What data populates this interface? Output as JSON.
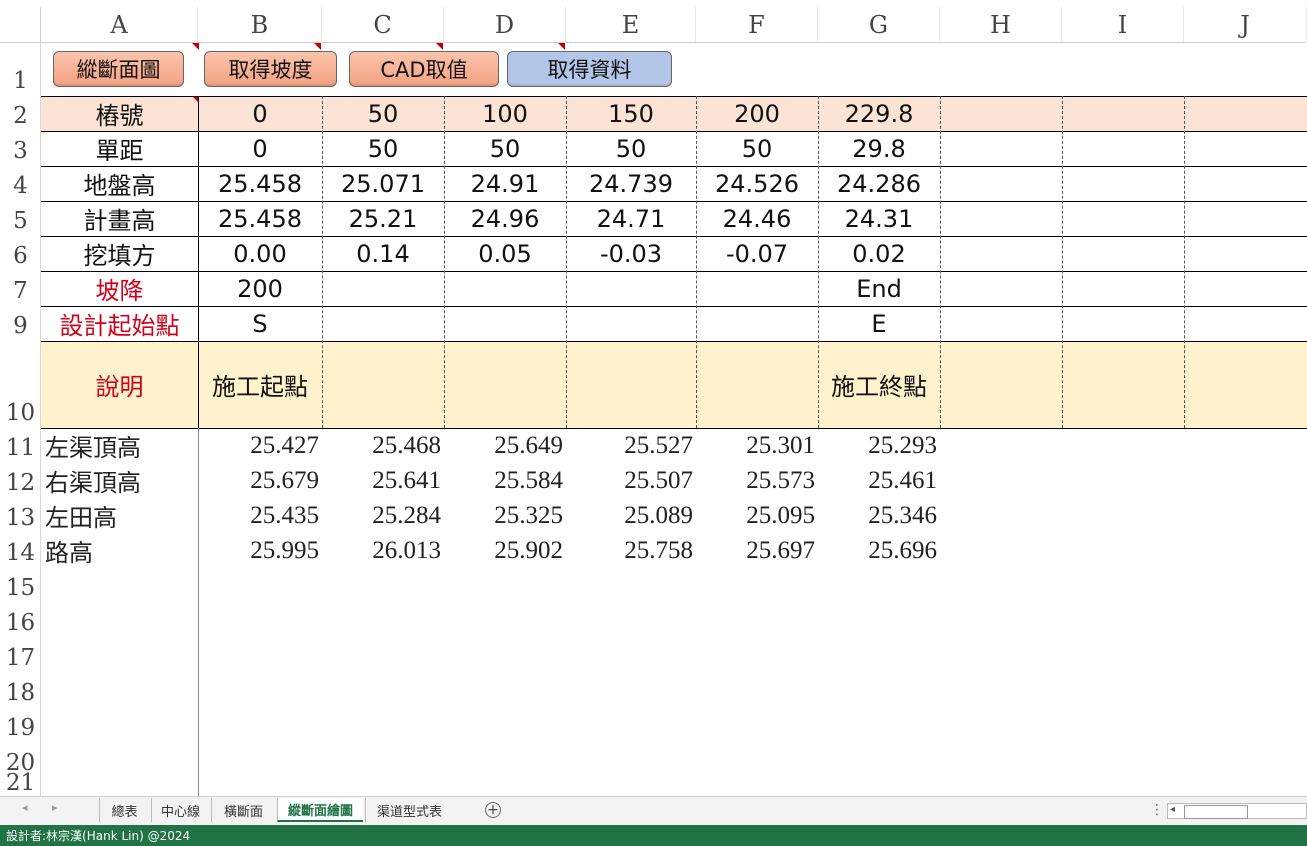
{
  "columns": [
    "A",
    "B",
    "C",
    "D",
    "E",
    "F",
    "G",
    "H",
    "I",
    "J"
  ],
  "row_numbers": [
    "1",
    "2",
    "3",
    "4",
    "5",
    "6",
    "7",
    "9",
    "10",
    "11",
    "12",
    "13",
    "14",
    "15",
    "16",
    "17",
    "18",
    "19",
    "20",
    "21"
  ],
  "buttons": [
    {
      "label": "縱斷面圖",
      "style": "orange"
    },
    {
      "label": "取得坡度",
      "style": "orange"
    },
    {
      "label": "CAD取值",
      "style": "orange"
    },
    {
      "label": "取得資料",
      "style": "blue"
    }
  ],
  "table": {
    "rows": [
      {
        "label": "樁號",
        "values": [
          "0",
          "50",
          "100",
          "150",
          "200",
          "229.8",
          "",
          "",
          ""
        ]
      },
      {
        "label": "單距",
        "values": [
          "0",
          "50",
          "50",
          "50",
          "50",
          "29.8",
          "",
          "",
          ""
        ]
      },
      {
        "label": "地盤高",
        "values": [
          "25.458",
          "25.071",
          "24.91",
          "24.739",
          "24.526",
          "24.286",
          "",
          "",
          ""
        ]
      },
      {
        "label": "計畫高",
        "values": [
          "25.458",
          "25.21",
          "24.96",
          "24.71",
          "24.46",
          "24.31",
          "",
          "",
          ""
        ]
      },
      {
        "label": "挖填方",
        "values": [
          "0.00",
          "0.14",
          "0.05",
          "-0.03",
          "-0.07",
          "0.02",
          "",
          "",
          ""
        ]
      },
      {
        "label": "坡降",
        "values": [
          "200",
          "",
          "",
          "",
          "",
          "End",
          "",
          "",
          ""
        ]
      },
      {
        "label": "設計起始點",
        "values": [
          "S",
          "",
          "",
          "",
          "",
          "E",
          "",
          "",
          ""
        ]
      },
      {
        "label": "說明",
        "values": [
          "施工起點",
          "",
          "",
          "",
          "",
          "施工終點",
          "",
          "",
          ""
        ]
      }
    ]
  },
  "lower_rows": [
    {
      "label": "左渠頂高",
      "values": [
        "25.427",
        "25.468",
        "25.649",
        "25.527",
        "25.301",
        "25.293"
      ]
    },
    {
      "label": "右渠頂高",
      "values": [
        "25.679",
        "25.641",
        "25.584",
        "25.507",
        "25.573",
        "25.461"
      ]
    },
    {
      "label": "左田高",
      "values": [
        "25.435",
        "25.284",
        "25.325",
        "25.089",
        "25.095",
        "25.346"
      ]
    },
    {
      "label": "路高",
      "values": [
        "25.995",
        "26.013",
        "25.902",
        "25.758",
        "25.697",
        "25.696"
      ]
    }
  ],
  "sheet_tabs": [
    "總表",
    "中心線",
    "橫斷面",
    "縱斷面繪圖",
    "渠道型式表"
  ],
  "active_tab": "縱斷面繪圖",
  "status_bar": "設計者:林宗漢(Hank Lin) @2024",
  "colors": {
    "header_band": "#fbe4d6",
    "remark_band": "#fff2cc",
    "status_bar": "#217346",
    "red_text": "#d0021b"
  }
}
